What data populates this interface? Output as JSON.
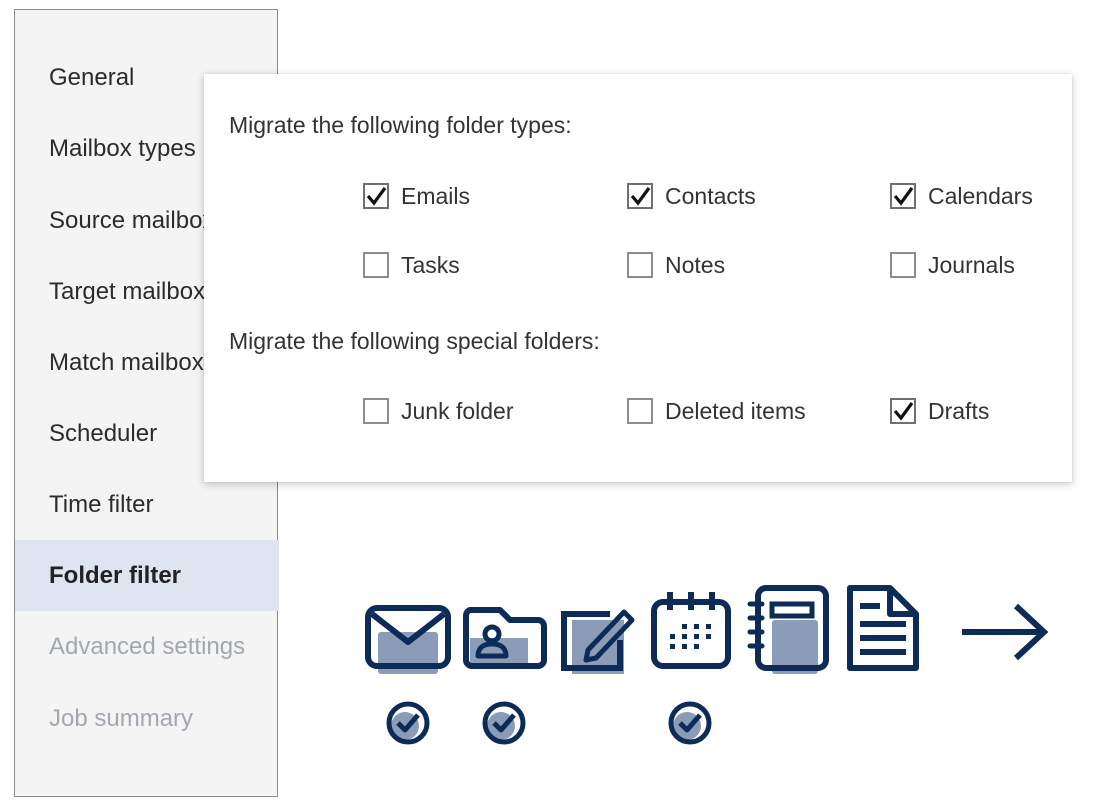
{
  "sidebar": {
    "items": [
      {
        "label": "General",
        "state": "normal"
      },
      {
        "label": "Mailbox types",
        "state": "normal"
      },
      {
        "label": "Source mailboxes",
        "state": "normal"
      },
      {
        "label": "Target mailboxes",
        "state": "normal"
      },
      {
        "label": "Match mailboxes",
        "state": "normal"
      },
      {
        "label": "Scheduler",
        "state": "normal"
      },
      {
        "label": "Time filter",
        "state": "normal"
      },
      {
        "label": "Folder filter",
        "state": "active"
      },
      {
        "label": "Advanced settings",
        "state": "disabled"
      },
      {
        "label": "Job summary",
        "state": "disabled"
      }
    ]
  },
  "panel": {
    "folder_types_label": "Migrate the following folder types:",
    "folder_types": [
      {
        "label": "Emails",
        "checked": true
      },
      {
        "label": "Contacts",
        "checked": true
      },
      {
        "label": "Calendars",
        "checked": true
      },
      {
        "label": "Tasks",
        "checked": false
      },
      {
        "label": "Notes",
        "checked": false
      },
      {
        "label": "Journals",
        "checked": false
      }
    ],
    "special_folders_label": "Migrate the following special folders:",
    "special_folders": [
      {
        "label": "Junk folder",
        "checked": false
      },
      {
        "label": "Deleted items",
        "checked": false
      },
      {
        "label": "Drafts",
        "checked": true
      }
    ]
  },
  "illustration": {
    "icons": [
      "envelope-icon",
      "contact-card-icon",
      "edit-note-icon",
      "calendar-icon",
      "notebook-icon",
      "document-icon",
      "arrow-right-icon"
    ],
    "checked_icons": [
      "envelope-icon",
      "contact-card-icon",
      "calendar-icon"
    ],
    "colors": {
      "navy": "#0d2b57",
      "fill": "#8b9cb8",
      "active_bg": "#dee5f0"
    }
  }
}
